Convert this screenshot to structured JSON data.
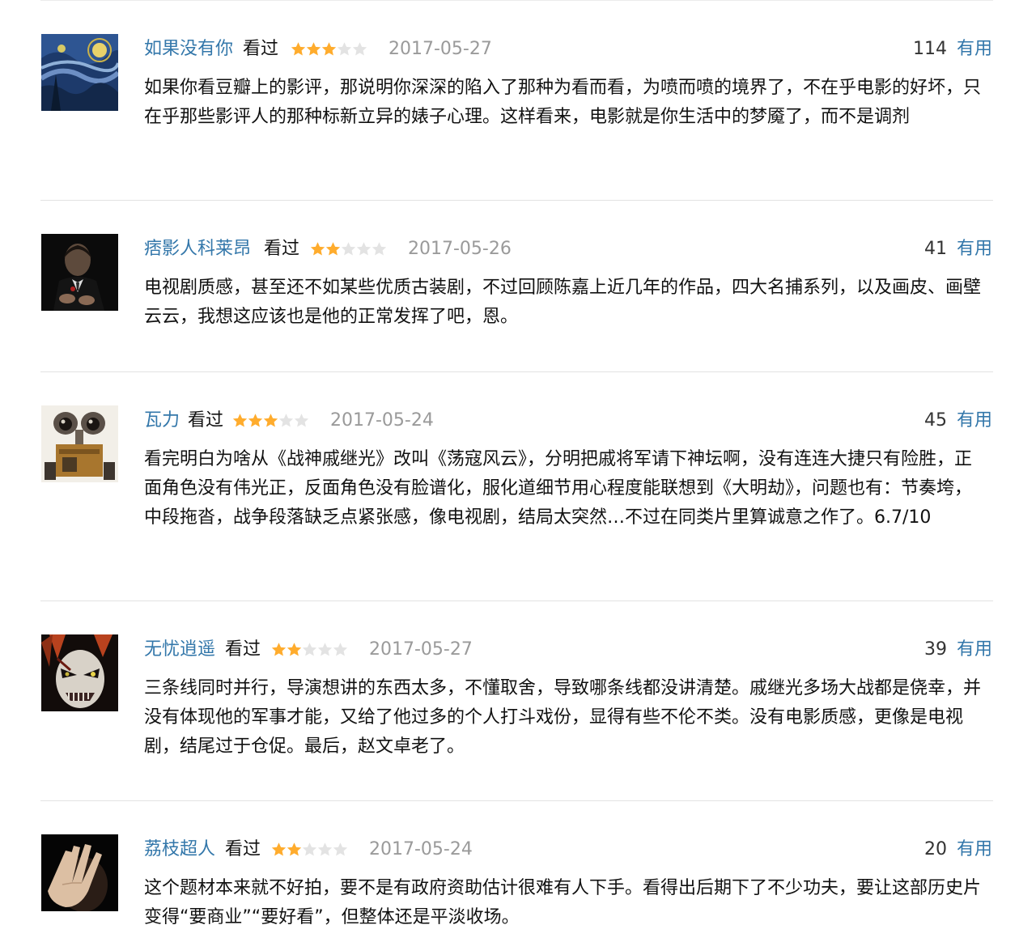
{
  "comments": [
    {
      "user": "如果没有你",
      "status": "看过",
      "rating": 3,
      "date": "2017-05-27",
      "votes": "114",
      "useful_label": "有用",
      "avatar_icon": "starry-night-avatar",
      "text": "如果你看豆瓣上的影评，那说明你深深的陷入了那种为看而看，为喷而喷的境界了，不在乎电影的好坏，只在乎那些影评人的那种标新立异的婊子心理。这样看来，电影就是你生活中的梦魇了，而不是调剂"
    },
    {
      "user": "痞影人科莱昂",
      "status": "看过",
      "rating": 2,
      "date": "2017-05-26",
      "votes": "41",
      "useful_label": "有用",
      "avatar_icon": "godfather-avatar",
      "text": "电视剧质感，甚至还不如某些优质古装剧，不过回顾陈嘉上近几年的作品，四大名捕系列，以及画皮、画壁云云，我想这应该也是他的正常发挥了吧，恩。"
    },
    {
      "user": "瓦力",
      "status": "看过",
      "rating": 3,
      "date": "2017-05-24",
      "votes": "45",
      "useful_label": "有用",
      "avatar_icon": "wall-e-avatar",
      "text": "看完明白为啥从《战神戚继光》改叫《荡寇风云》，分明把戚将军请下神坛啊，没有连连大捷只有险胜，正面角色没有伟光正，反面角色没有脸谱化，服化道细节用心程度能联想到《大明劫》，问题也有：节奏垮，中段拖沓，战争段落缺乏点紧张感，像电视剧，结局太突然…不过在同类片里算诚意之作了。6.7/10"
    },
    {
      "user": "无忧逍遥",
      "status": "看过",
      "rating": 2,
      "date": "2017-05-27",
      "votes": "39",
      "useful_label": "有用",
      "avatar_icon": "mask-face-avatar",
      "text": "三条线同时并行，导演想讲的东西太多，不懂取舍，导致哪条线都没讲清楚。戚继光多场大战都是侥幸，并没有体现他的军事才能，又给了他过多的个人打斗戏份，显得有些不伦不类。没有电影质感，更像是电视剧，结尾过于仓促。最后，赵文卓老了。"
    },
    {
      "user": "荔枝超人",
      "status": "看过",
      "rating": 2,
      "date": "2017-05-24",
      "votes": "20",
      "useful_label": "有用",
      "avatar_icon": "hand-over-face-avatar",
      "text": "这个题材本来就不好拍，要不是有政府资助估计很难有人下手。看得出后期下了不少功夫，要让这部历史片变得“要商业”“要好看”，但整体还是平淡收场。"
    }
  ],
  "colors": {
    "link": "#3377aa",
    "star_on": "#ffac2d",
    "star_off": "#e3e3e3",
    "date": "#9a9a9a",
    "divider": "#e2e2e2"
  }
}
